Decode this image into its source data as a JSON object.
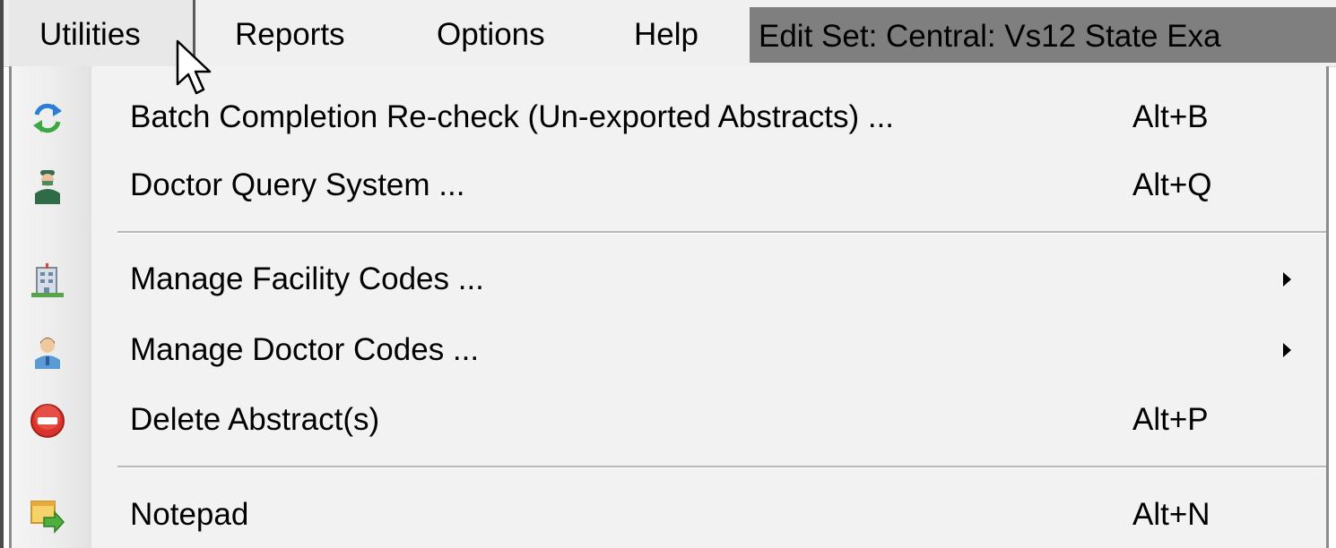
{
  "menubar": {
    "items": [
      {
        "label": "Utilities"
      },
      {
        "label": "Reports"
      },
      {
        "label": "Options"
      },
      {
        "label": "Help"
      }
    ],
    "edit_set_text": "Edit Set: Central: Vs12 State Exa"
  },
  "utilities_menu": {
    "items": [
      {
        "label": "Batch Completion Re-check (Un-exported Abstracts) ...",
        "shortcut": "Alt+B",
        "icon": "recycle-arrows-icon"
      },
      {
        "label": "Doctor Query System ...",
        "shortcut": "Alt+Q",
        "icon": "doctor-icon"
      },
      {
        "label": "Manage Facility Codes ...",
        "shortcut": "",
        "icon": "building-icon",
        "submenu": true
      },
      {
        "label": "Manage Doctor Codes ...",
        "shortcut": "",
        "icon": "person-icon",
        "submenu": true
      },
      {
        "label": "Delete Abstract(s)",
        "shortcut": "Alt+P",
        "icon": "delete-icon"
      },
      {
        "label": "Notepad",
        "shortcut": "Alt+N",
        "icon": "notepad-export-icon"
      }
    ]
  },
  "colors": {
    "menubar_bg": "#f0f0f0",
    "dropdown_bg": "#f2f2f2",
    "edit_set_bg": "#7f7f7f",
    "delete_red": "#d9342b"
  }
}
